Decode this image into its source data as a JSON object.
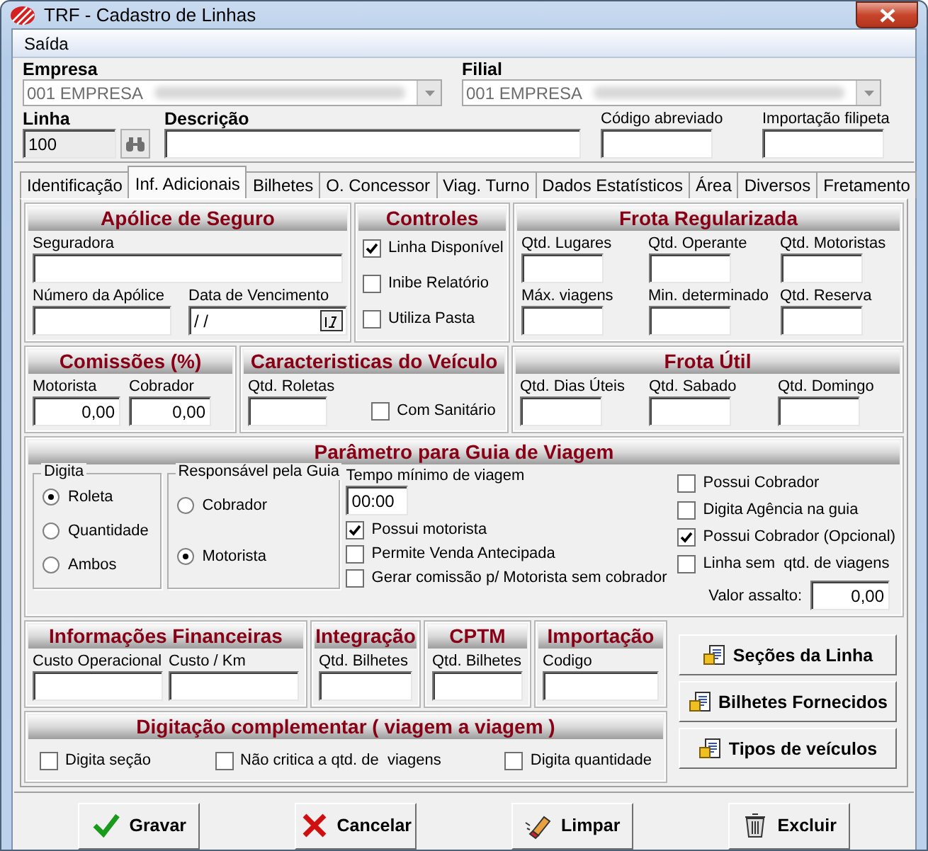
{
  "window": {
    "title": "TRF - Cadastro de Linhas"
  },
  "menu": [
    {
      "label": "Saída"
    }
  ],
  "header": {
    "empresa": {
      "label": "Empresa",
      "value": "001 EMPRESA"
    },
    "filial": {
      "label": "Filial",
      "value": "001 EMPRESA"
    },
    "linha": {
      "label": "Linha",
      "value": "100"
    },
    "descricao": {
      "label": "Descrição"
    },
    "codigo_abreviado": {
      "label": "Código abreviado"
    },
    "importacao_filipeta": {
      "label": "Importação filipeta"
    }
  },
  "tabs": [
    {
      "label": "Identificação",
      "selected": false
    },
    {
      "label": "Inf. Adicionais",
      "selected": true
    },
    {
      "label": "Bilhetes",
      "selected": false
    },
    {
      "label": "O. Concessor",
      "selected": false
    },
    {
      "label": "Viag. Turno",
      "selected": false
    },
    {
      "label": "Dados Estatísticos",
      "selected": false
    },
    {
      "label": "Área",
      "selected": false
    },
    {
      "label": "Diversos",
      "selected": false
    },
    {
      "label": "Fretamento",
      "selected": false
    }
  ],
  "apolice": {
    "title": "Apólice de Seguro",
    "seguradora": {
      "label": "Seguradora"
    },
    "numero": {
      "label": "Número da Apólice"
    },
    "vencimento": {
      "label": "Data de Vencimento",
      "value": "/ /"
    }
  },
  "controles": {
    "title": "Controles",
    "checks": [
      {
        "label": "Linha Disponível",
        "checked": true
      },
      {
        "label": "Inibe Relatório",
        "checked": false
      },
      {
        "label": "Utiliza Pasta",
        "checked": false
      }
    ]
  },
  "frota_regularizada": {
    "title": "Frota Regularizada",
    "fields": [
      {
        "label": "Qtd. Lugares"
      },
      {
        "label": "Qtd. Operante"
      },
      {
        "label": "Qtd. Motoristas"
      },
      {
        "label": "Máx. viagens"
      },
      {
        "label": "Min. determinado"
      },
      {
        "label": "Qtd. Reserva"
      }
    ]
  },
  "comissoes": {
    "title": "Comissões (%)",
    "fields": [
      {
        "label": "Motorista",
        "value": "0,00"
      },
      {
        "label": "Cobrador",
        "value": "0,00"
      }
    ]
  },
  "caracteristicas": {
    "title": "Caracteristicas do Veículo",
    "fields": [
      {
        "label": "Qtd. Roletas"
      }
    ],
    "checks": [
      {
        "label": "Com Sanitário",
        "checked": false
      }
    ]
  },
  "frota_util": {
    "title": "Frota Útil",
    "fields": [
      {
        "label": "Qtd. Dias Úteis"
      },
      {
        "label": "Qtd. Sabado"
      },
      {
        "label": "Qtd. Domingo"
      }
    ]
  },
  "parametro": {
    "title": "Parâmetro para Guia de Viagem",
    "digita": {
      "legend": "Digita",
      "options": [
        {
          "label": "Roleta",
          "selected": true
        },
        {
          "label": "Quantidade",
          "selected": false
        },
        {
          "label": "Ambos",
          "selected": false
        }
      ]
    },
    "responsavel": {
      "legend": "Responsável pela Guia",
      "options": [
        {
          "label": "Cobrador",
          "selected": false
        },
        {
          "label": "Motorista",
          "selected": true
        }
      ]
    },
    "tempo": {
      "label": "Tempo mínimo de viagem",
      "value": "00:00"
    },
    "checks_middle": [
      {
        "label": "Possui motorista",
        "checked": true
      },
      {
        "label": "Permite Venda Antecipada",
        "checked": false
      },
      {
        "label": "Gerar comissão p/ Motorista sem cobrador",
        "checked": false
      }
    ],
    "checks_right": [
      {
        "label": "Possui Cobrador",
        "checked": false
      },
      {
        "label": "Digita Agência na guia",
        "checked": false
      },
      {
        "label": "Possui Cobrador (Opcional)",
        "checked": true
      },
      {
        "label": "Linha sem  qtd. de viagens",
        "checked": false
      }
    ],
    "valor_assalto": {
      "label": "Valor assalto:",
      "value": "0,00"
    }
  },
  "financeiras": {
    "title": "Informações Financeiras",
    "fields": [
      {
        "label": "Custo Operacional"
      },
      {
        "label": "Custo / Km"
      }
    ]
  },
  "integracao": {
    "title": "Integração",
    "fields": [
      {
        "label": "Qtd. Bilhetes"
      }
    ]
  },
  "cptm": {
    "title": "CPTM",
    "fields": [
      {
        "label": "Qtd. Bilhetes"
      }
    ]
  },
  "importacao": {
    "title": "Importação",
    "fields": [
      {
        "label": "Codigo"
      }
    ]
  },
  "digitacao": {
    "title": "Digitação complementar ( viagem a viagem )",
    "checks": [
      {
        "label": "Digita seção",
        "checked": false
      },
      {
        "label": "Não critica a qtd. de  viagens",
        "checked": false
      },
      {
        "label": "Digita quantidade",
        "checked": false
      }
    ]
  },
  "side_buttons": [
    {
      "label": "Seções da Linha"
    },
    {
      "label": "Bilhetes Fornecidos"
    },
    {
      "label": "Tipos de veículos"
    }
  ],
  "actions": [
    {
      "label": "Gravar",
      "kind": "save"
    },
    {
      "label": "Cancelar",
      "kind": "cancel"
    },
    {
      "label": "Limpar",
      "kind": "clear"
    },
    {
      "label": "Excluir",
      "kind": "delete"
    }
  ]
}
